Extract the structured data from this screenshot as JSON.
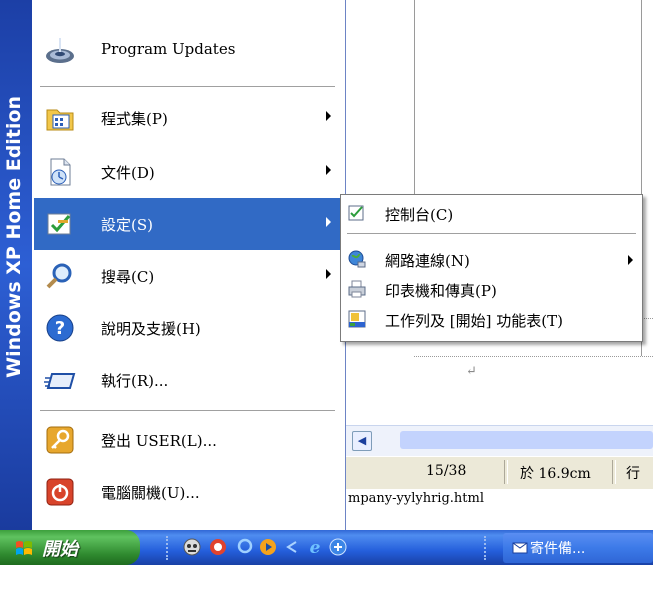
{
  "start_menu": {
    "banner": "Windows XP Home Edition",
    "items": [
      {
        "label": "Program Updates",
        "icon": "program-updates-icon",
        "has_submenu": false
      },
      {
        "label": "程式集(P)",
        "icon": "programs-folder-icon",
        "has_submenu": true
      },
      {
        "label": "文件(D)",
        "icon": "documents-icon",
        "has_submenu": true
      },
      {
        "label": "設定(S)",
        "icon": "settings-icon",
        "has_submenu": true,
        "selected": true
      },
      {
        "label": "搜尋(C)",
        "icon": "search-icon",
        "has_submenu": true
      },
      {
        "label": "說明及支援(H)",
        "icon": "help-icon",
        "has_submenu": false
      },
      {
        "label": "執行(R)...",
        "icon": "run-icon",
        "has_submenu": false
      },
      {
        "label": "登出 USER(L)...",
        "icon": "logoff-icon",
        "has_submenu": false
      },
      {
        "label": "電腦關機(U)...",
        "icon": "shutdown-icon",
        "has_submenu": false
      }
    ]
  },
  "settings_submenu": {
    "items": [
      {
        "label": "控制台(C)",
        "icon": "control-panel-icon",
        "has_submenu": false
      },
      {
        "label": "網路連線(N)",
        "icon": "network-connections-icon",
        "has_submenu": true
      },
      {
        "label": "印表機和傳真(P)",
        "icon": "printers-faxes-icon",
        "has_submenu": false
      },
      {
        "label": "工作列及 [開始] 功能表(T)",
        "icon": "taskbar-icon",
        "has_submenu": false
      }
    ]
  },
  "document": {
    "paragraph_mark": "↵",
    "status": {
      "page": "15/38",
      "position": "於 16.9cm",
      "line": "行"
    },
    "tab_text": "mpany-yylyhrig.html"
  },
  "taskbar": {
    "start_label": "開始",
    "task_button": "寄件備...",
    "colors": {
      "menu_highlight": "#316ac5",
      "taskbar": "#245edb",
      "start_button": "#3c9f3c"
    }
  }
}
